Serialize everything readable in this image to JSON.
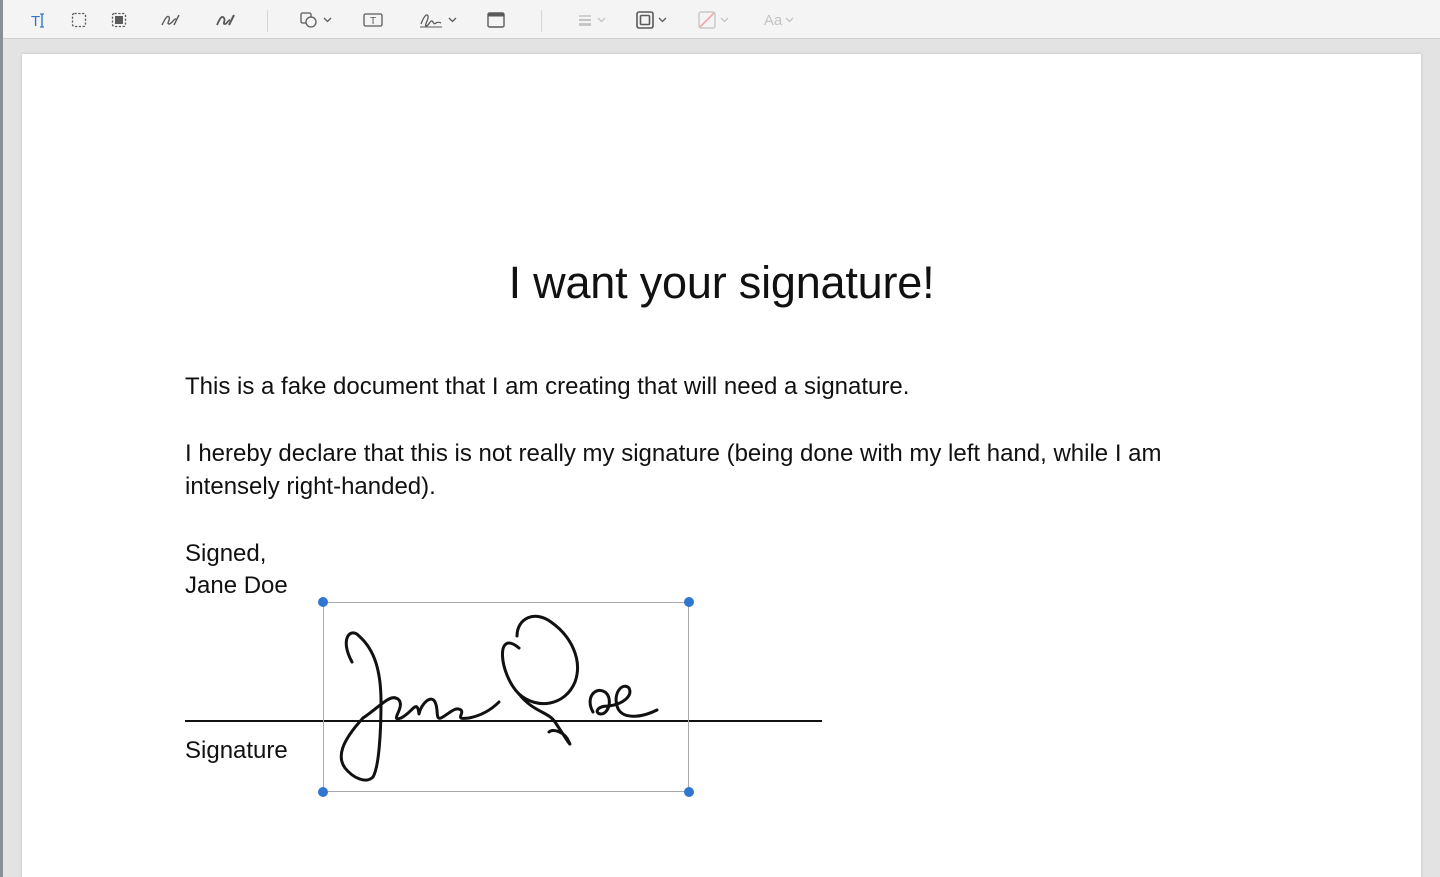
{
  "toolbar": {
    "tools": [
      {
        "name": "text-selection",
        "icon": "text-cursor-icon"
      },
      {
        "name": "rectangular-selection",
        "icon": "dashed-rect-icon"
      },
      {
        "name": "redact",
        "icon": "redact-rect-icon"
      },
      {
        "name": "sketch",
        "icon": "sketch-pen-icon"
      },
      {
        "name": "draw",
        "icon": "draw-pen-icon"
      },
      {
        "name": "shapes",
        "icon": "shapes-icon"
      },
      {
        "name": "text-box",
        "icon": "text-box-icon"
      },
      {
        "name": "sign",
        "icon": "signature-icon"
      },
      {
        "name": "note",
        "icon": "note-window-icon"
      },
      {
        "name": "shape-style",
        "icon": "lines-icon"
      },
      {
        "name": "border-color",
        "icon": "border-square-icon"
      },
      {
        "name": "fill-color",
        "icon": "fill-slash-icon"
      },
      {
        "name": "text-style",
        "icon": "aa-icon"
      }
    ],
    "text_style_label": "Aa",
    "active_color": "#2f77d0"
  },
  "document": {
    "title": "I want your signature!",
    "paragraph1": "This is a fake document that I am creating that will need a signature.",
    "paragraph2_line1": "I hereby declare that this is not really my signature (being done with my left hand, while I am",
    "paragraph2_line2": "intensely right-handed).",
    "signed": "Signed,",
    "name": "Jane Doe",
    "signature_label": "Signature"
  },
  "signature_annotation": {
    "selected": true,
    "handle_color": "#2f77d0"
  }
}
